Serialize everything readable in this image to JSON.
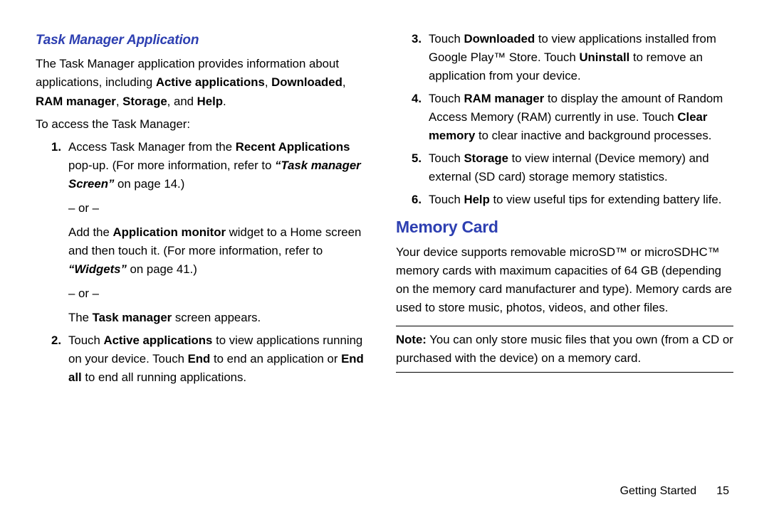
{
  "left": {
    "h3": "Task Manager Application",
    "intro_pre": "The Task Manager application provides information about applications, including ",
    "intro_bold1": "Active applications",
    "intro_sep1": ", ",
    "intro_bold2": "Downloaded",
    "intro_sep2": ", ",
    "intro_bold3": "RAM manager",
    "intro_sep3": ", ",
    "intro_bold4": "Storage",
    "intro_sep4": ", and ",
    "intro_bold5": "Help",
    "intro_post": ".",
    "access": "To access the Task Manager:",
    "li1": {
      "num": "1.",
      "a_pre": "Access Task Manager from the ",
      "a_b1": "Recent Applications",
      "a_post": " pop-up. (For more information, refer to ",
      "a_ref": "“Task manager Screen”",
      "a_pg": " on page 14.)",
      "or1": "– or –",
      "b_pre": "Add the ",
      "b_b1": "Application monitor",
      "b_mid": " widget to a Home screen and then touch it. (For more information, refer to ",
      "b_ref": "“Widgets”",
      "b_pg": " on page 41.)",
      "or2": "– or –",
      "c_pre": "The ",
      "c_b1": "Task manager",
      "c_post": " screen appears."
    },
    "li2": {
      "num": "2.",
      "pre": "Touch ",
      "b1": "Active applications",
      "mid1": " to view applications running on your device. Touch ",
      "b2": "End",
      "mid2": " to end an application or ",
      "b3": "End all",
      "post": " to end all running applications."
    }
  },
  "right": {
    "li3": {
      "num": "3.",
      "pre": "Touch ",
      "b1": "Downloaded",
      "mid1": " to view applications installed from Google Play™ Store. Touch ",
      "b2": "Uninstall",
      "post": " to remove an application from your device."
    },
    "li4": {
      "num": "4.",
      "pre": "Touch ",
      "b1": "RAM manager",
      "mid1": " to display the amount of Random Access Memory (RAM) currently in use. Touch ",
      "b2": "Clear memory",
      "post": " to clear inactive and background processes."
    },
    "li5": {
      "num": "5.",
      "pre": "Touch ",
      "b1": "Storage",
      "post": " to view internal (Device memory) and external (SD card) storage memory statistics."
    },
    "li6": {
      "num": "6.",
      "pre": "Touch ",
      "b1": "Help",
      "post": " to view useful tips for extending battery life."
    },
    "h2": "Memory Card",
    "mem_body": "Your device supports removable microSD™ or microSDHC™ memory cards with maximum capacities of 64 GB (depending on the memory card manufacturer and type). Memory cards are used to store music, photos, videos, and other files.",
    "note_label": "Note:",
    "note_body": " You can only store music files that you own (from a CD or purchased with the device) on a memory card."
  },
  "footer": {
    "section": "Getting Started",
    "page": "15"
  }
}
